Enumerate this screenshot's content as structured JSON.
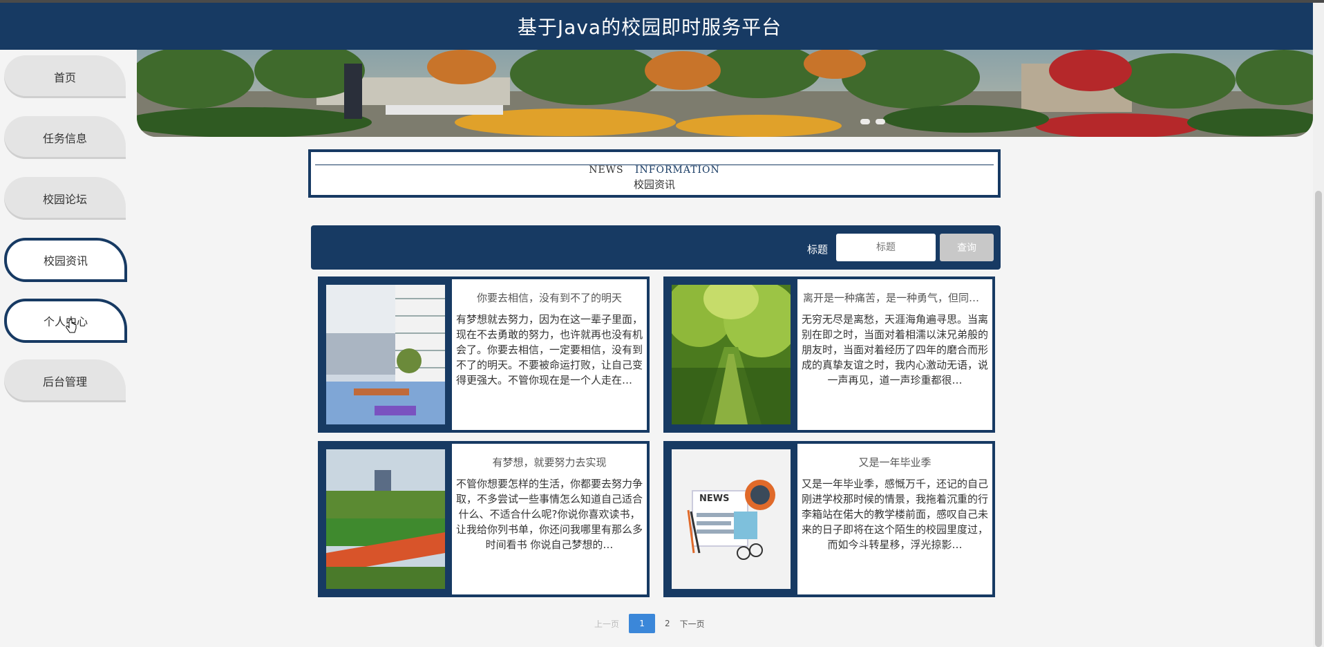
{
  "header": {
    "title": "基于Java的校园即时服务平台"
  },
  "sidebar": {
    "items": [
      {
        "label": "首页"
      },
      {
        "label": "任务信息"
      },
      {
        "label": "校园论坛"
      },
      {
        "label": "校园资讯",
        "active": true
      },
      {
        "label": "个人中心"
      },
      {
        "label": "后台管理"
      }
    ]
  },
  "section": {
    "en_prefix": "NEWS",
    "en_suffix": "INFORMATION",
    "cn": "校园资讯"
  },
  "search": {
    "label": "标题",
    "placeholder": "标题",
    "button": "查询"
  },
  "cards": [
    {
      "title": "你要去相信，没有到不了的明天",
      "desc": "有梦想就去努力，因为在这一辈子里面，现在不去勇敢的努力，也许就再也没有机会了。你要去相信，一定要相信，没有到不了的明天。不要被命运打败，让自己变得更强大。不管你现在是一个人走在异乡的街道上…"
    },
    {
      "title": "离开是一种痛苦，是一种勇气，但同样也是一种希望",
      "desc": "无穷无尽是离愁，天涯海角遍寻思。当离别在即之时，当面对着相濡以沫兄弟般的朋友时，当面对着经历了四年的磨合而形成的真挚友谊之时，我内心激动无语，说一声再见，道一声珍重都很…"
    },
    {
      "title": "有梦想，就要努力去实现",
      "desc": "不管你想要怎样的生活，你都要去努力争取，不多尝试一些事情怎么知道自己适合什么、不适合什么呢?你说你喜欢读书，让我给你列书单，你还问我哪里有那么多时间看书 你说自己梦想的…"
    },
    {
      "title": "又是一年毕业季",
      "desc": "又是一年毕业季，感慨万千，还记的自己刚进学校那时候的情景，我拖着沉重的行李箱站在偌大的教学楼前面，感叹自己未来的日子即将在这个陌生的校园里度过，而如今斗转星移，浮光掠影…"
    }
  ],
  "pager": {
    "prev": "上一页",
    "current": "1",
    "page2": "2",
    "next": "下一页"
  }
}
